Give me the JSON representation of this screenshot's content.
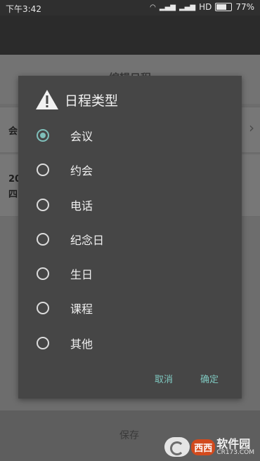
{
  "status_bar": {
    "time": "下午3:42",
    "network": "HD",
    "battery": "77%",
    "battery_level": 0.77
  },
  "background_app": {
    "header_title": "编辑日程",
    "row1_text": "会",
    "row2_line1": "20",
    "row2_line2": "四",
    "bottom_text": "保存"
  },
  "dialog": {
    "title": "日程类型",
    "icon": "warning-icon",
    "options": [
      {
        "label": "会议",
        "checked": true
      },
      {
        "label": "约会",
        "checked": false
      },
      {
        "label": "电话",
        "checked": false
      },
      {
        "label": "纪念日",
        "checked": false
      },
      {
        "label": "生日",
        "checked": false
      },
      {
        "label": "课程",
        "checked": false
      },
      {
        "label": "其他",
        "checked": false
      }
    ],
    "cancel_label": "取消",
    "ok_label": "确定"
  },
  "watermark": {
    "badge": "西西",
    "name": "软件园",
    "url": "CR173.COM"
  },
  "colors": {
    "accent": "#7fc8c0",
    "dialog_bg": "#464646",
    "status_bar_bg": "#2f2f2f"
  }
}
